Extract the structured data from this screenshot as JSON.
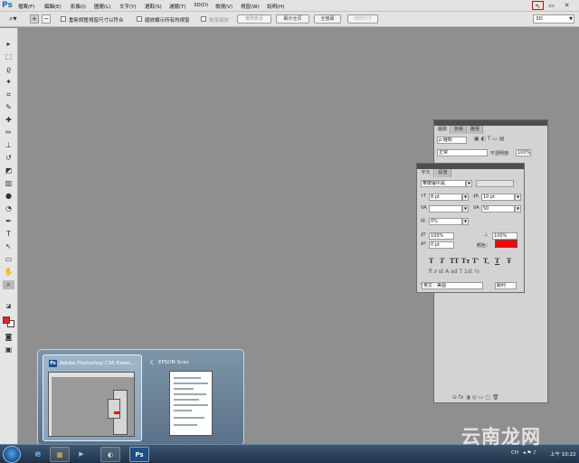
{
  "app": {
    "logo": "Ps"
  },
  "menu": [
    "檔案(F)",
    "編輯(E)",
    "影像(I)",
    "圖層(L)",
    "文字(Y)",
    "選取(S)",
    "濾鏡(T)",
    "3D(D)",
    "檢視(V)",
    "視窗(W)",
    "說明(H)"
  ],
  "window_controls": {
    "workspace_icon": "↖",
    "restore": "▭",
    "close": "✕"
  },
  "options_bar": {
    "resize_windows_label": "重新調整視窗尺寸以符合",
    "zoom_all_windows_label": "縮放顯示所有的視窗",
    "scrubby_zoom_label": "拖曳縮放",
    "actual_pixels_label": "實際像素",
    "fit_screen_label": "顯示全頁",
    "fill_screen_label": "全螢幕",
    "print_size_label": "列印尺寸",
    "workspace_mode": "3D"
  },
  "tools": [
    {
      "icon": "▸",
      "name": "move-tool-icon"
    },
    {
      "icon": "⬚",
      "name": "marquee-tool-icon"
    },
    {
      "icon": "ϱ",
      "name": "lasso-tool-icon"
    },
    {
      "icon": "✦",
      "name": "quick-select-tool-icon"
    },
    {
      "icon": "⌗",
      "name": "crop-tool-icon"
    },
    {
      "icon": "✎",
      "name": "eyedropper-tool-icon"
    },
    {
      "icon": "✚",
      "name": "healing-brush-tool-icon"
    },
    {
      "icon": "✏",
      "name": "brush-tool-icon"
    },
    {
      "icon": "⊥",
      "name": "clone-stamp-tool-icon"
    },
    {
      "icon": "↺",
      "name": "history-brush-tool-icon"
    },
    {
      "icon": "◩",
      "name": "eraser-tool-icon"
    },
    {
      "icon": "▥",
      "name": "gradient-tool-icon"
    },
    {
      "icon": "●",
      "name": "blur-tool-icon"
    },
    {
      "icon": "◔",
      "name": "dodge-tool-icon"
    },
    {
      "icon": "✒",
      "name": "pen-tool-icon"
    },
    {
      "icon": "T",
      "name": "type-tool-icon"
    },
    {
      "icon": "↖",
      "name": "path-select-tool-icon"
    },
    {
      "icon": "▭",
      "name": "shape-tool-icon"
    },
    {
      "icon": "✋",
      "name": "hand-tool-icon"
    },
    {
      "icon": "⌕",
      "name": "zoom-tool-icon"
    }
  ],
  "colors": {
    "foreground": "#ff1a1a",
    "background": "#ffffff",
    "text_color": "#ff0000"
  },
  "layers_panel": {
    "tabs": [
      "圖層",
      "色版",
      "路徑"
    ],
    "kind_filter": "ρ 種類",
    "blend_mode": "正常",
    "opacity_label": "不透明度:",
    "opacity_value": "100%"
  },
  "character_panel": {
    "tabs": [
      "字元",
      "段落"
    ],
    "font_family": "華康儷中黑",
    "font_style": "-",
    "font_size": "8 pt",
    "leading": "10 pt",
    "kerning": "",
    "tracking": "50",
    "tsume": "0%",
    "vertical_scale": "100%",
    "horizontal_scale": "100%",
    "baseline_shift": "0 pt",
    "color_label": "顏色：",
    "style_buttons": [
      "T",
      "T",
      "TT",
      "Tт",
      "T'",
      "T,",
      "T",
      "Ŧ"
    ],
    "language": "英文：美國",
    "anti_alias_label": "aa",
    "anti_alias": "銳利"
  },
  "taskbar_preview": {
    "items": [
      {
        "title": "Adobe Photoshop CS6 Exten...",
        "icon": "Ps"
      },
      {
        "title": "EPSON Scan",
        "icon": "☇"
      }
    ]
  },
  "taskbar": {
    "buttons": [
      {
        "icon": "e",
        "name": "ie-taskbar-button"
      },
      {
        "icon": "▦",
        "name": "explorer-taskbar-button"
      },
      {
        "icon": "▶",
        "name": "media-player-taskbar-button"
      },
      {
        "icon": "◐",
        "name": "scanner-taskbar-button"
      },
      {
        "icon": "Ps",
        "name": "photoshop-taskbar-button"
      }
    ],
    "language_indicator": "CH",
    "clock": "上午 10:22"
  },
  "watermark": "云南龙网"
}
